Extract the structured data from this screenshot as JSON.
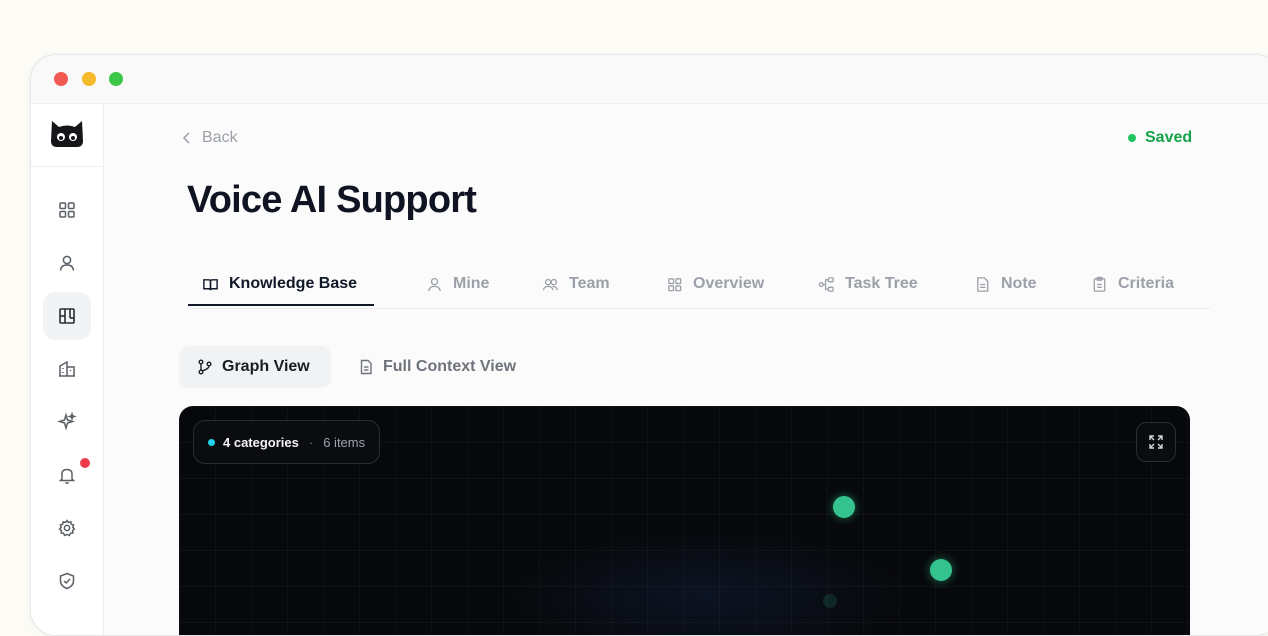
{
  "window": {
    "controls": [
      "close",
      "minimize",
      "maximize"
    ]
  },
  "sidebar": {
    "logo": "cat-logo-icon",
    "items": [
      {
        "icon": "grid-icon",
        "active": false
      },
      {
        "icon": "user-icon",
        "active": false
      },
      {
        "icon": "board-icon",
        "active": true
      },
      {
        "icon": "building-icon",
        "active": false
      },
      {
        "icon": "sparkle-icon",
        "active": false
      },
      {
        "icon": "bell-icon",
        "active": false,
        "notification": true
      },
      {
        "icon": "gear-icon",
        "active": false
      },
      {
        "icon": "shield-check-icon",
        "active": false
      }
    ]
  },
  "header": {
    "back_label": "Back",
    "status_label": "Saved",
    "status_color": "#16a34a",
    "title": "Voice AI Support"
  },
  "tabs": [
    {
      "label": "Knowledge Base",
      "icon": "book-open-icon",
      "active": true
    },
    {
      "label": "Mine",
      "icon": "user-icon",
      "active": false
    },
    {
      "label": "Team",
      "icon": "users-icon",
      "active": false
    },
    {
      "label": "Overview",
      "icon": "grid-icon",
      "active": false
    },
    {
      "label": "Task Tree",
      "icon": "tree-icon",
      "active": false
    },
    {
      "label": "Note",
      "icon": "file-icon",
      "active": false
    },
    {
      "label": "Criteria",
      "icon": "clipboard-icon",
      "active": false
    }
  ],
  "views": [
    {
      "label": "Graph View",
      "icon": "branch-icon",
      "active": true
    },
    {
      "label": "Full Context View",
      "icon": "document-icon",
      "active": false
    }
  ],
  "graph": {
    "categories_label": "4 categories",
    "separator": "·",
    "items_label": "6 items",
    "expand_icon": "expand-icon",
    "node_color": "#34c38f",
    "legend_dot_color": "#22d3ee"
  }
}
